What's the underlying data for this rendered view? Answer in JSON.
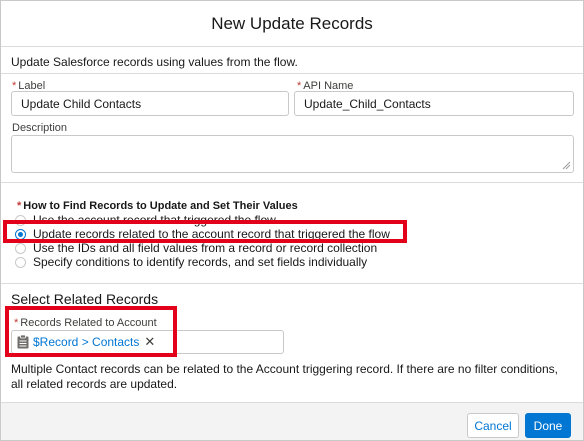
{
  "modal": {
    "title": "New Update Records",
    "intro": "Update Salesforce records using values from the flow."
  },
  "fields": {
    "label": {
      "label": "Label",
      "required_mark": "*",
      "value": "Update Child Contacts"
    },
    "api_name": {
      "label": "API Name",
      "required_mark": "*",
      "value": "Update_Child_Contacts"
    },
    "description": {
      "label": "Description",
      "value": ""
    }
  },
  "find_records": {
    "label": "How to Find Records to Update and Set Their Values",
    "required_mark": "*",
    "options": [
      {
        "label": "Use the account record that triggered the flow",
        "selected": false
      },
      {
        "label": "Update records related to the account record that triggered the flow",
        "selected": true
      },
      {
        "label": "Use the IDs and all field values from a record or record collection",
        "selected": false
      },
      {
        "label": "Specify conditions to identify records, and set fields individually",
        "selected": false
      }
    ]
  },
  "related": {
    "title": "Select Related Records",
    "field_label": "Records Related to Account",
    "required_mark": "*",
    "pill_value": "$Record > Contacts",
    "note": "Multiple Contact records can be related to the Account triggering record. If there are no filter conditions, all related records are updated."
  },
  "footer": {
    "cancel_label": "Cancel",
    "done_label": "Done"
  },
  "colors": {
    "brand": "#0176d3",
    "required": "#c23934",
    "highlight": "#e3001b"
  },
  "icons": {
    "pill_icon": "resource-clipboard-icon",
    "pill_remove": "close-icon"
  }
}
